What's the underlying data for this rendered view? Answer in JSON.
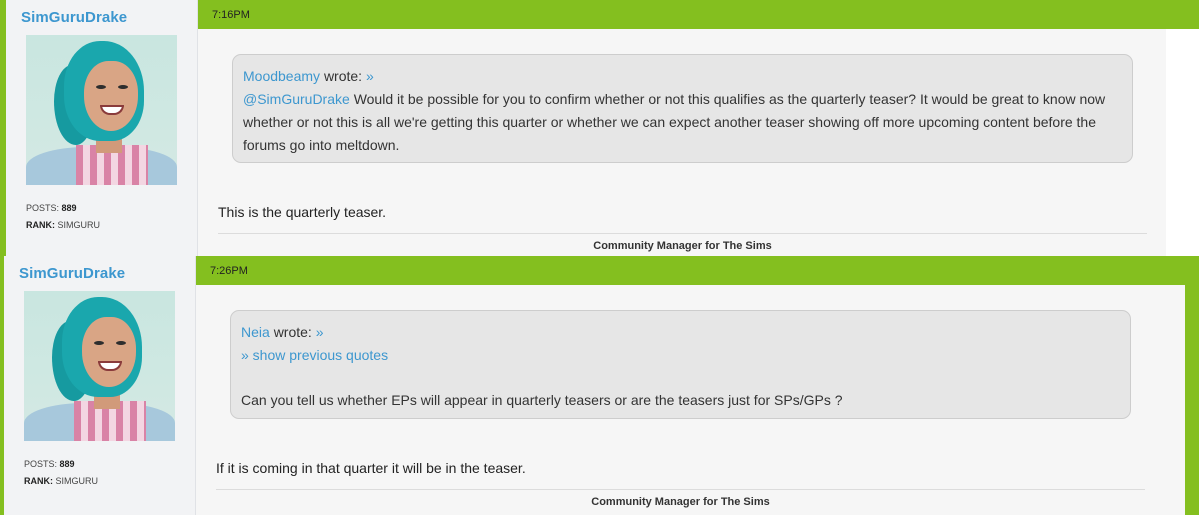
{
  "posts": [
    {
      "author": "SimGuruDrake",
      "posts_label": "POSTS:",
      "posts_count": "889",
      "rank_label": "RANK:",
      "rank_value": "SIMGURU",
      "time": "7:16PM",
      "quote": {
        "author": "Moodbeamy",
        "wrote": "wrote:",
        "arrow": "»",
        "mention": "@SimGuruDrake",
        "text": "Would it be possible for you to confirm whether or not this qualifies as the quarterly teaser? It would be great to know now whether or not this is all we're getting this quarter or whether we can expect another teaser showing off more upcoming content before the forums go into meltdown."
      },
      "body": "This is the quarterly teaser.",
      "signature": "Community Manager for The Sims"
    },
    {
      "author": "SimGuruDrake",
      "posts_label": "POSTS:",
      "posts_count": "889",
      "rank_label": "RANK:",
      "rank_value": "SIMGURU",
      "time": "7:26PM",
      "quote": {
        "author": "Neia",
        "wrote": "wrote:",
        "arrow": "»",
        "show_previous": "» show previous quotes",
        "text": "Can you tell us whether EPs will appear in quarterly teasers or are the teasers just for SPs/GPs ?"
      },
      "body": "If it is coming in that quarter it will be in the teaser.",
      "signature": "Community Manager for The Sims"
    }
  ],
  "colors": {
    "accent_green": "#84bf1f",
    "link_blue": "#3d97cf",
    "sidebar_bg": "#f2f3f5",
    "quote_bg": "#e6e6e6"
  }
}
